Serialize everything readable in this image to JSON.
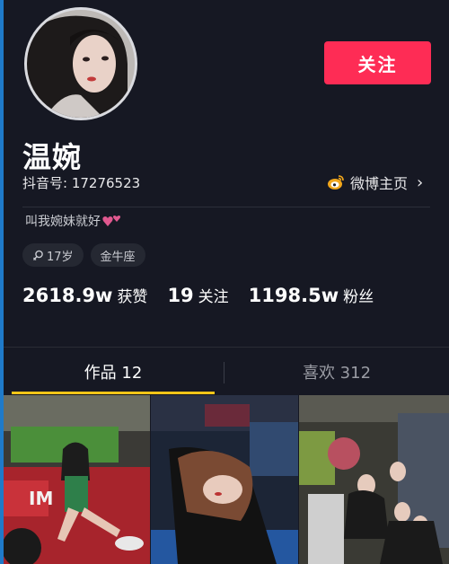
{
  "profile": {
    "follow_label": "关注",
    "name": "温婉",
    "douyin_id": "抖音号: 17276523",
    "weibo_label": "微博主页",
    "bio": "叫我婉妹就好",
    "tags": [
      {
        "label": "17岁",
        "icon": "female-icon"
      },
      {
        "label": "金牛座"
      }
    ],
    "stats": [
      {
        "value": "2618.9w",
        "label": "获赞"
      },
      {
        "value": "19",
        "label": "关注"
      },
      {
        "value": "1198.5w",
        "label": "粉丝"
      }
    ]
  },
  "tabs": [
    {
      "label": "作品 12",
      "active": true
    },
    {
      "label": "喜欢 312",
      "active": false
    }
  ],
  "colors": {
    "background": "#161823",
    "accent": "#fe2c55",
    "tab_indicator": "#f5c518",
    "tag_bg": "#252832"
  }
}
